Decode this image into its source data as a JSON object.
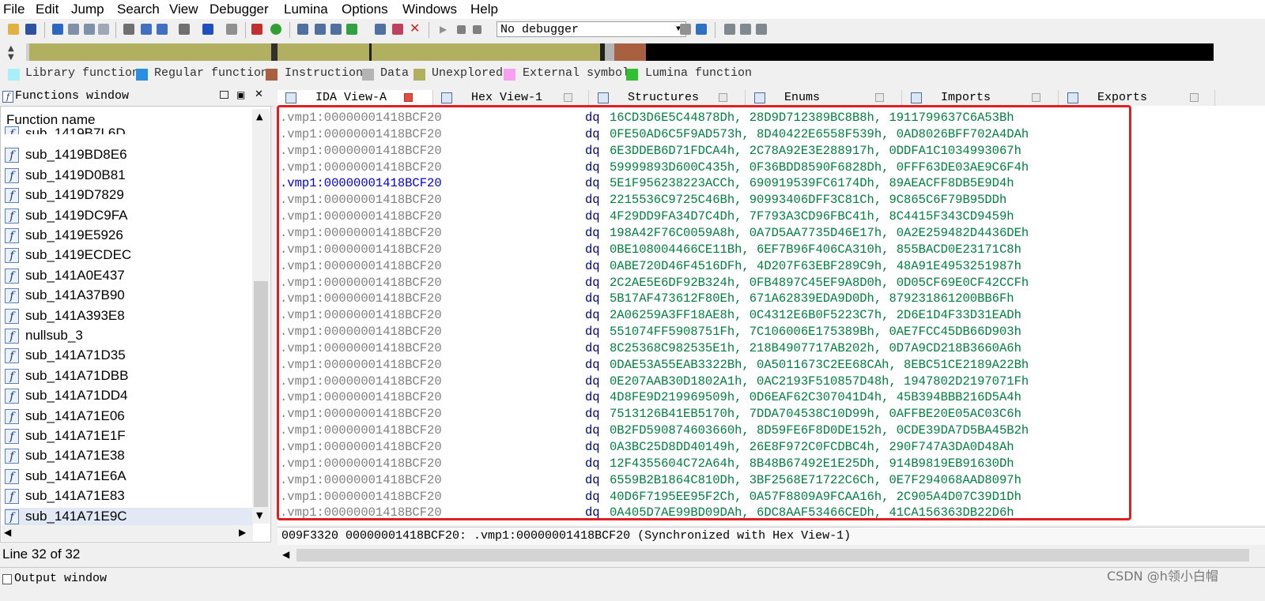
{
  "menu": [
    "File",
    "Edit",
    "Jump",
    "Search",
    "View",
    "Debugger",
    "Lumina",
    "Options",
    "Windows",
    "Help"
  ],
  "toolbar": {
    "debugger_select": "No debugger"
  },
  "legend": [
    {
      "label": "Library function",
      "color": "#a8f0f8"
    },
    {
      "label": "Regular function",
      "color": "#2a8fe0"
    },
    {
      "label": "Instruction",
      "color": "#a86040"
    },
    {
      "label": "Data",
      "color": "#b4b4b4"
    },
    {
      "label": "Unexplored",
      "color": "#b0b060"
    },
    {
      "label": "External symbol",
      "color": "#f8a0f0"
    },
    {
      "label": "Lumina function",
      "color": "#30c030"
    }
  ],
  "functions_window": {
    "title": "Functions window",
    "column_header": "Function name",
    "items": [
      "sub_1419B7L6D",
      "sub_1419BD8E6",
      "sub_1419D0B81",
      "sub_1419D7829",
      "sub_1419DC9FA",
      "sub_1419E5926",
      "sub_1419ECDEC",
      "sub_141A0E437",
      "sub_141A37B90",
      "sub_141A393E8",
      "nullsub_3",
      "sub_141A71D35",
      "sub_141A71DBB",
      "sub_141A71DD4",
      "sub_141A71E06",
      "sub_141A71E1F",
      "sub_141A71E38",
      "sub_141A71E6A",
      "sub_141A71E83",
      "sub_141A71E9C"
    ],
    "selected_index": 19,
    "line_status": "Line 32 of 32"
  },
  "tabs": [
    {
      "label": "IDA View-A",
      "active": true
    },
    {
      "label": "Hex View-1",
      "active": false
    },
    {
      "label": "Structures",
      "active": false
    },
    {
      "label": "Enums",
      "active": false
    },
    {
      "label": "Imports",
      "active": false
    },
    {
      "label": "Exports",
      "active": false
    }
  ],
  "ida_view": {
    "current_row": 4,
    "rows": [
      {
        "addr": ".vmp1:00000001418BCF20",
        "mnemonic": "dq",
        "operands": "16CD3D6E5C44878Dh, 28D9D712389BC8B8h, 1911799637C6A53Bh"
      },
      {
        "addr": ".vmp1:00000001418BCF20",
        "mnemonic": "dq",
        "operands": "0FE50AD6C5F9AD573h, 8D40422E6558F539h, 0AD8026BFF702A4DAh"
      },
      {
        "addr": ".vmp1:00000001418BCF20",
        "mnemonic": "dq",
        "operands": "6E3DDEB6D71FDCA4h, 2C78A92E3E288917h, 0DDFA1C1034993067h"
      },
      {
        "addr": ".vmp1:00000001418BCF20",
        "mnemonic": "dq",
        "operands": "59999893D600C435h, 0F36BDD8590F6828Dh, 0FFF63DE03AE9C6F4h"
      },
      {
        "addr": ".vmp1:00000001418BCF20",
        "mnemonic": "dq",
        "operands": "5E1F956238223ACCh, 690919539FC6174Dh, 89AEACFF8DB5E9D4h"
      },
      {
        "addr": ".vmp1:00000001418BCF20",
        "mnemonic": "dq",
        "operands": "2215536C9725C46Bh, 90993406DFF3C81Ch, 9C865C6F79B95DDh"
      },
      {
        "addr": ".vmp1:00000001418BCF20",
        "mnemonic": "dq",
        "operands": "4F29DD9FA34D7C4Dh, 7F793A3CD96FBC41h, 8C4415F343CD9459h"
      },
      {
        "addr": ".vmp1:00000001418BCF20",
        "mnemonic": "dq",
        "operands": "198A42F76C0059A8h, 0A7D5AA7735D46E17h, 0A2E259482D4436DEh"
      },
      {
        "addr": ".vmp1:00000001418BCF20",
        "mnemonic": "dq",
        "operands": "0BE108004466CE11Bh, 6EF7B96F406CA310h, 855BACD0E23171C8h"
      },
      {
        "addr": ".vmp1:00000001418BCF20",
        "mnemonic": "dq",
        "operands": "0ABE720D46F4516DFh, 4D207F63EBF289C9h, 48A91E4953251987h"
      },
      {
        "addr": ".vmp1:00000001418BCF20",
        "mnemonic": "dq",
        "operands": "2C2AE5E6DF92B324h, 0FB4897C45EF9A8D0h, 0D05CF69E0CF42CCFh"
      },
      {
        "addr": ".vmp1:00000001418BCF20",
        "mnemonic": "dq",
        "operands": "5B17AF473612F80Eh, 671A62839EDA9D0Dh, 879231861200BB6Fh"
      },
      {
        "addr": ".vmp1:00000001418BCF20",
        "mnemonic": "dq",
        "operands": "2A06259A3FF18AE8h, 0C4312E6B0F5223C7h, 2D6E1D4F33D31EADh"
      },
      {
        "addr": ".vmp1:00000001418BCF20",
        "mnemonic": "dq",
        "operands": "551074FF5908751Fh, 7C106006E175389Bh, 0AE7FCC45DB66D903h"
      },
      {
        "addr": ".vmp1:00000001418BCF20",
        "mnemonic": "dq",
        "operands": "8C25368C982535E1h, 218B4907717AB202h, 0D7A9CD218B3660A6h"
      },
      {
        "addr": ".vmp1:00000001418BCF20",
        "mnemonic": "dq",
        "operands": "0DAE53A55EAB3322Bh, 0A5011673C2EE68CAh, 8EBC51CE2189A22Bh"
      },
      {
        "addr": ".vmp1:00000001418BCF20",
        "mnemonic": "dq",
        "operands": "0E207AAB30D1802A1h, 0AC2193F510857D48h, 1947802D2197071Fh"
      },
      {
        "addr": ".vmp1:00000001418BCF20",
        "mnemonic": "dq",
        "operands": "4D8FE9D219969509h, 0D6EAF62C307041D4h, 45B394BBB216D5A4h"
      },
      {
        "addr": ".vmp1:00000001418BCF20",
        "mnemonic": "dq",
        "operands": "7513126B41EB5170h, 7DDA704538C10D99h, 0AFFBE20E05AC03C6h"
      },
      {
        "addr": ".vmp1:00000001418BCF20",
        "mnemonic": "dq",
        "operands": "0B2FD590874603660h, 8D59FE6F8D0DE152h, 0CDE39DA7D5BA45B2h"
      },
      {
        "addr": ".vmp1:00000001418BCF20",
        "mnemonic": "dq",
        "operands": "0A3BC25D8DD40149h, 26E8F972C0FCDBC4h, 290F747A3DA0D48Ah"
      },
      {
        "addr": ".vmp1:00000001418BCF20",
        "mnemonic": "dq",
        "operands": "12F4355604C72A64h, 8B48B67492E1E25Dh, 914B9819EB91630Dh"
      },
      {
        "addr": ".vmp1:00000001418BCF20",
        "mnemonic": "dq",
        "operands": "6559B2B1864C810Dh, 3BF2568E71722C6Ch, 0E7F294068AAD8097h"
      },
      {
        "addr": ".vmp1:00000001418BCF20",
        "mnemonic": "dq",
        "operands": "40D6F7195EE95F2Ch, 0A57F8809A9FCAA16h, 2C905A4D07C39D1Dh"
      },
      {
        "addr": ".vmp1:00000001418BCF20",
        "mnemonic": "dq",
        "operands": "0A405D7AE99BD09DAh, 6DC8AAF53466CEDh, 41CA156363DB22D6h"
      }
    ],
    "status_line": "009F3320 00000001418BCF20: .vmp1:00000001418BCF20 (Synchronized with Hex View-1)"
  },
  "output_window": {
    "title": "Output window"
  },
  "watermark": "CSDN @h领小白帽"
}
